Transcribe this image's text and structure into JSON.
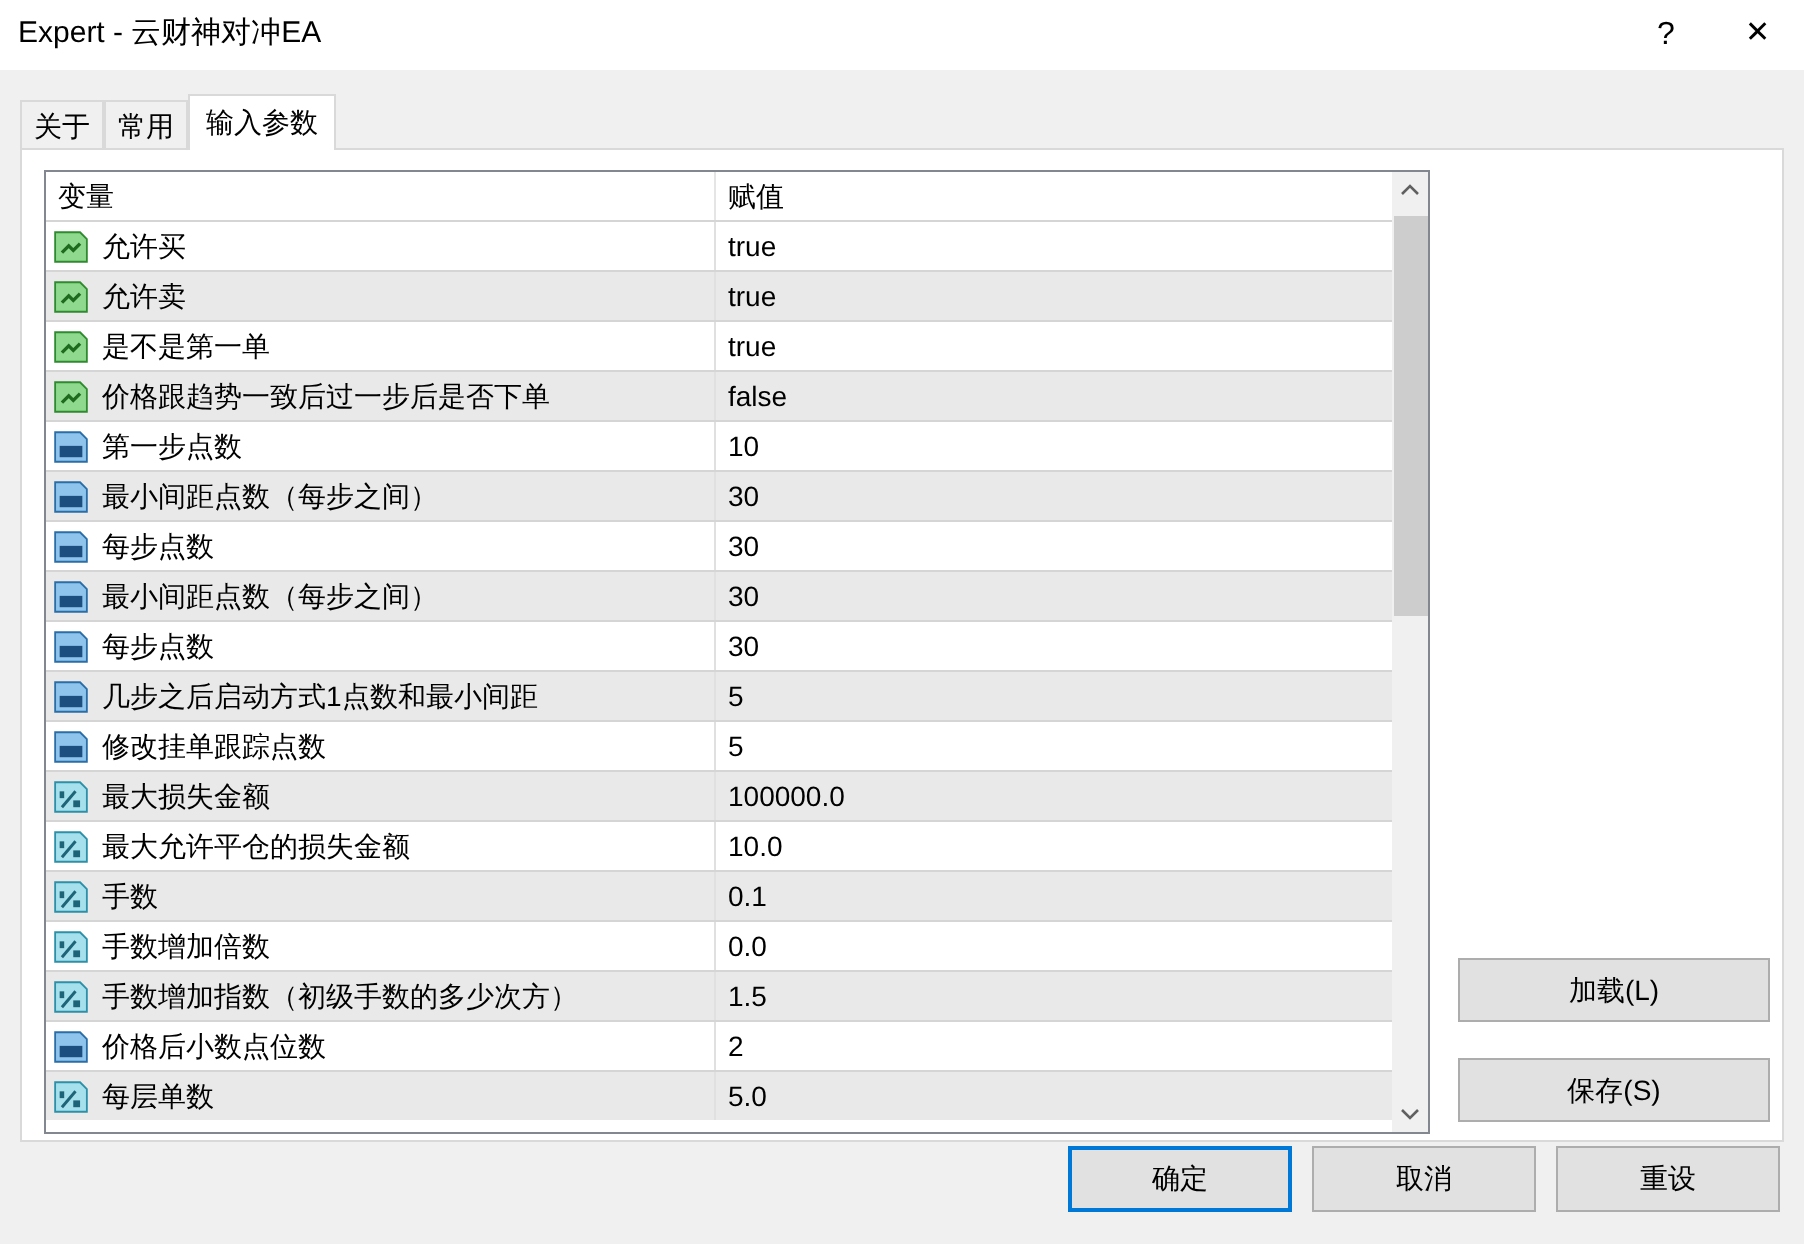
{
  "window": {
    "title": "Expert - 云财神对冲EA",
    "help": "?",
    "close": "✕"
  },
  "tabs": [
    {
      "label": "关于",
      "selected": false
    },
    {
      "label": "常用",
      "selected": false
    },
    {
      "label": "输入参数",
      "selected": true
    }
  ],
  "table": {
    "columns": [
      "变量",
      "赋值"
    ],
    "rows": [
      {
        "kind": "bool",
        "name": "允许买",
        "value": "true"
      },
      {
        "kind": "bool",
        "name": "允许卖",
        "value": "true"
      },
      {
        "kind": "bool",
        "name": "是不是第一单",
        "value": "true"
      },
      {
        "kind": "bool",
        "name": "价格跟趋势一致后过一步后是否下单",
        "value": "false"
      },
      {
        "kind": "int",
        "name": "第一步点数",
        "value": "10"
      },
      {
        "kind": "int",
        "name": "最小间距点数（每步之间）",
        "value": "30"
      },
      {
        "kind": "int",
        "name": "每步点数",
        "value": "30"
      },
      {
        "kind": "int",
        "name": "最小间距点数（每步之间）",
        "value": "30"
      },
      {
        "kind": "int",
        "name": "每步点数",
        "value": "30"
      },
      {
        "kind": "int",
        "name": "几步之后启动方式1点数和最小间距",
        "value": "5"
      },
      {
        "kind": "int",
        "name": "修改挂单跟踪点数",
        "value": "5"
      },
      {
        "kind": "double",
        "name": "最大损失金额",
        "value": "100000.0"
      },
      {
        "kind": "double",
        "name": "最大允许平仓的损失金额",
        "value": "10.0"
      },
      {
        "kind": "double",
        "name": "手数",
        "value": "0.1"
      },
      {
        "kind": "double",
        "name": "手数增加倍数",
        "value": "0.0"
      },
      {
        "kind": "double",
        "name": "手数增加指数（初级手数的多少次方）",
        "value": "1.5"
      },
      {
        "kind": "int",
        "name": "价格后小数点位数",
        "value": "2"
      },
      {
        "kind": "double",
        "name": "每层单数",
        "value": "5.0"
      }
    ]
  },
  "side_buttons": [
    "加载(L)",
    "保存(S)"
  ],
  "footer_buttons": [
    {
      "label": "确定",
      "default": true
    },
    {
      "label": "取消",
      "default": false
    },
    {
      "label": "重设",
      "default": false
    }
  ]
}
